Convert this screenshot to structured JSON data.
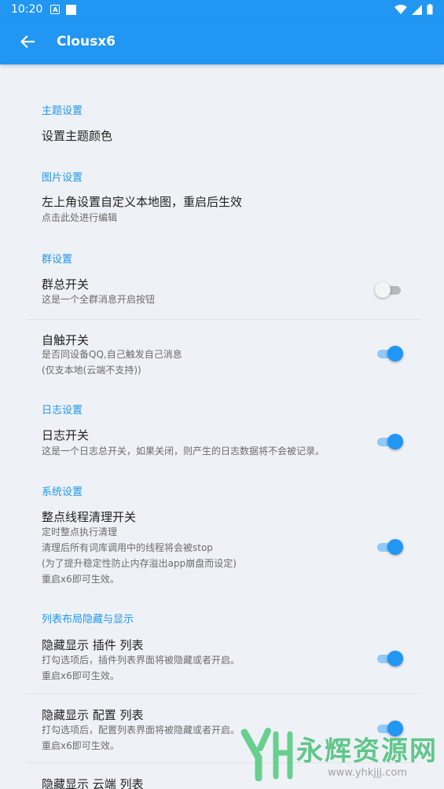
{
  "status": {
    "time": "10:20",
    "a_label": "A"
  },
  "appbar": {
    "title": "Clousx6"
  },
  "sections": {
    "theme": "主题设置",
    "image": "图片设置",
    "group": "群设置",
    "log": "日志设置",
    "system": "系统设置",
    "layout": "列表布局隐藏与显示"
  },
  "items": {
    "theme_color": {
      "title": "设置主题颜色"
    },
    "map_image": {
      "title": "左上角设置自定义本地图，重启后生效",
      "sub": "点击此处进行编辑"
    },
    "group_switch": {
      "title": "群总开关",
      "sub": "这是一个全群消息开启按钮",
      "on": false
    },
    "self_trigger": {
      "title": "自触开关",
      "sub1": "是否同设备QQ,自己触发自己消息",
      "sub2": "(仅支本地(云端不支持))",
      "on": true
    },
    "log_switch": {
      "title": "日志开关",
      "sub": "这是一个日志总开关，如果关闭，则产生的日志数据将不会被记录。",
      "on": true
    },
    "thread_clean": {
      "title": "整点线程清理开关",
      "sub1": "定时整点执行清理",
      "sub2": "清理后所有词库调用中的线程将会被stop",
      "sub3": "(为了提升稳定性防止内存溢出app崩盘而设定)",
      "sub4": "重启x6即可生效。",
      "on": true
    },
    "hide_plugin": {
      "title": "隐藏显示 插件 列表",
      "sub1": "打勾选项后，插件列表界面将被隐藏或者开启。",
      "sub2": "重启x6即可生效。",
      "on": true
    },
    "hide_config": {
      "title": "隐藏显示 配置 列表",
      "sub1": "打勾选项后，配置列表界面将被隐藏或者开启。",
      "sub2": "重启x6即可生效。",
      "on": true
    },
    "hide_cloud": {
      "title": "隐藏显示 云端 列表"
    }
  },
  "watermark": {
    "text": "永辉资源网",
    "url": "www.yhkjjj.com"
  },
  "colors": {
    "accent": "#2196f3",
    "background": "#eef2f7"
  }
}
